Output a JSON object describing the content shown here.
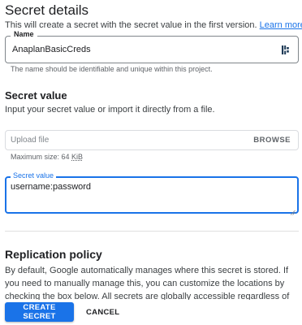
{
  "header": {
    "title": "Secret details",
    "intro": "This will create a secret with the secret value in the first version.",
    "learn_more": "Learn more"
  },
  "name_field": {
    "label": "Name",
    "value": "AnaplanBasicCreds",
    "hint": "The name should be identifiable and unique within this project.",
    "icon": "password-manager-key-icon"
  },
  "secret_value_section": {
    "heading": "Secret value",
    "description": "Input your secret value or import it directly from a file.",
    "upload": {
      "placeholder": "Upload file",
      "browse_label": "BROWSE",
      "max_size_prefix": "Maximum size: 64 ",
      "max_size_unit": "KiB"
    },
    "secret_input": {
      "label": "Secret value",
      "value": "username:password"
    }
  },
  "replication": {
    "heading": "Replication policy",
    "body": "By default, Google automatically manages where this secret is stored. If you need to manually manage this, you can customize the locations by checking the box below. All secrets are globally accessible regardless of how they are replicated and stored. The"
  },
  "footer": {
    "create_label": "CREATE SECRET",
    "cancel_label": "CANCEL"
  },
  "colors": {
    "accent": "#1a73e8",
    "text": "#202124",
    "muted": "#5f6368"
  }
}
